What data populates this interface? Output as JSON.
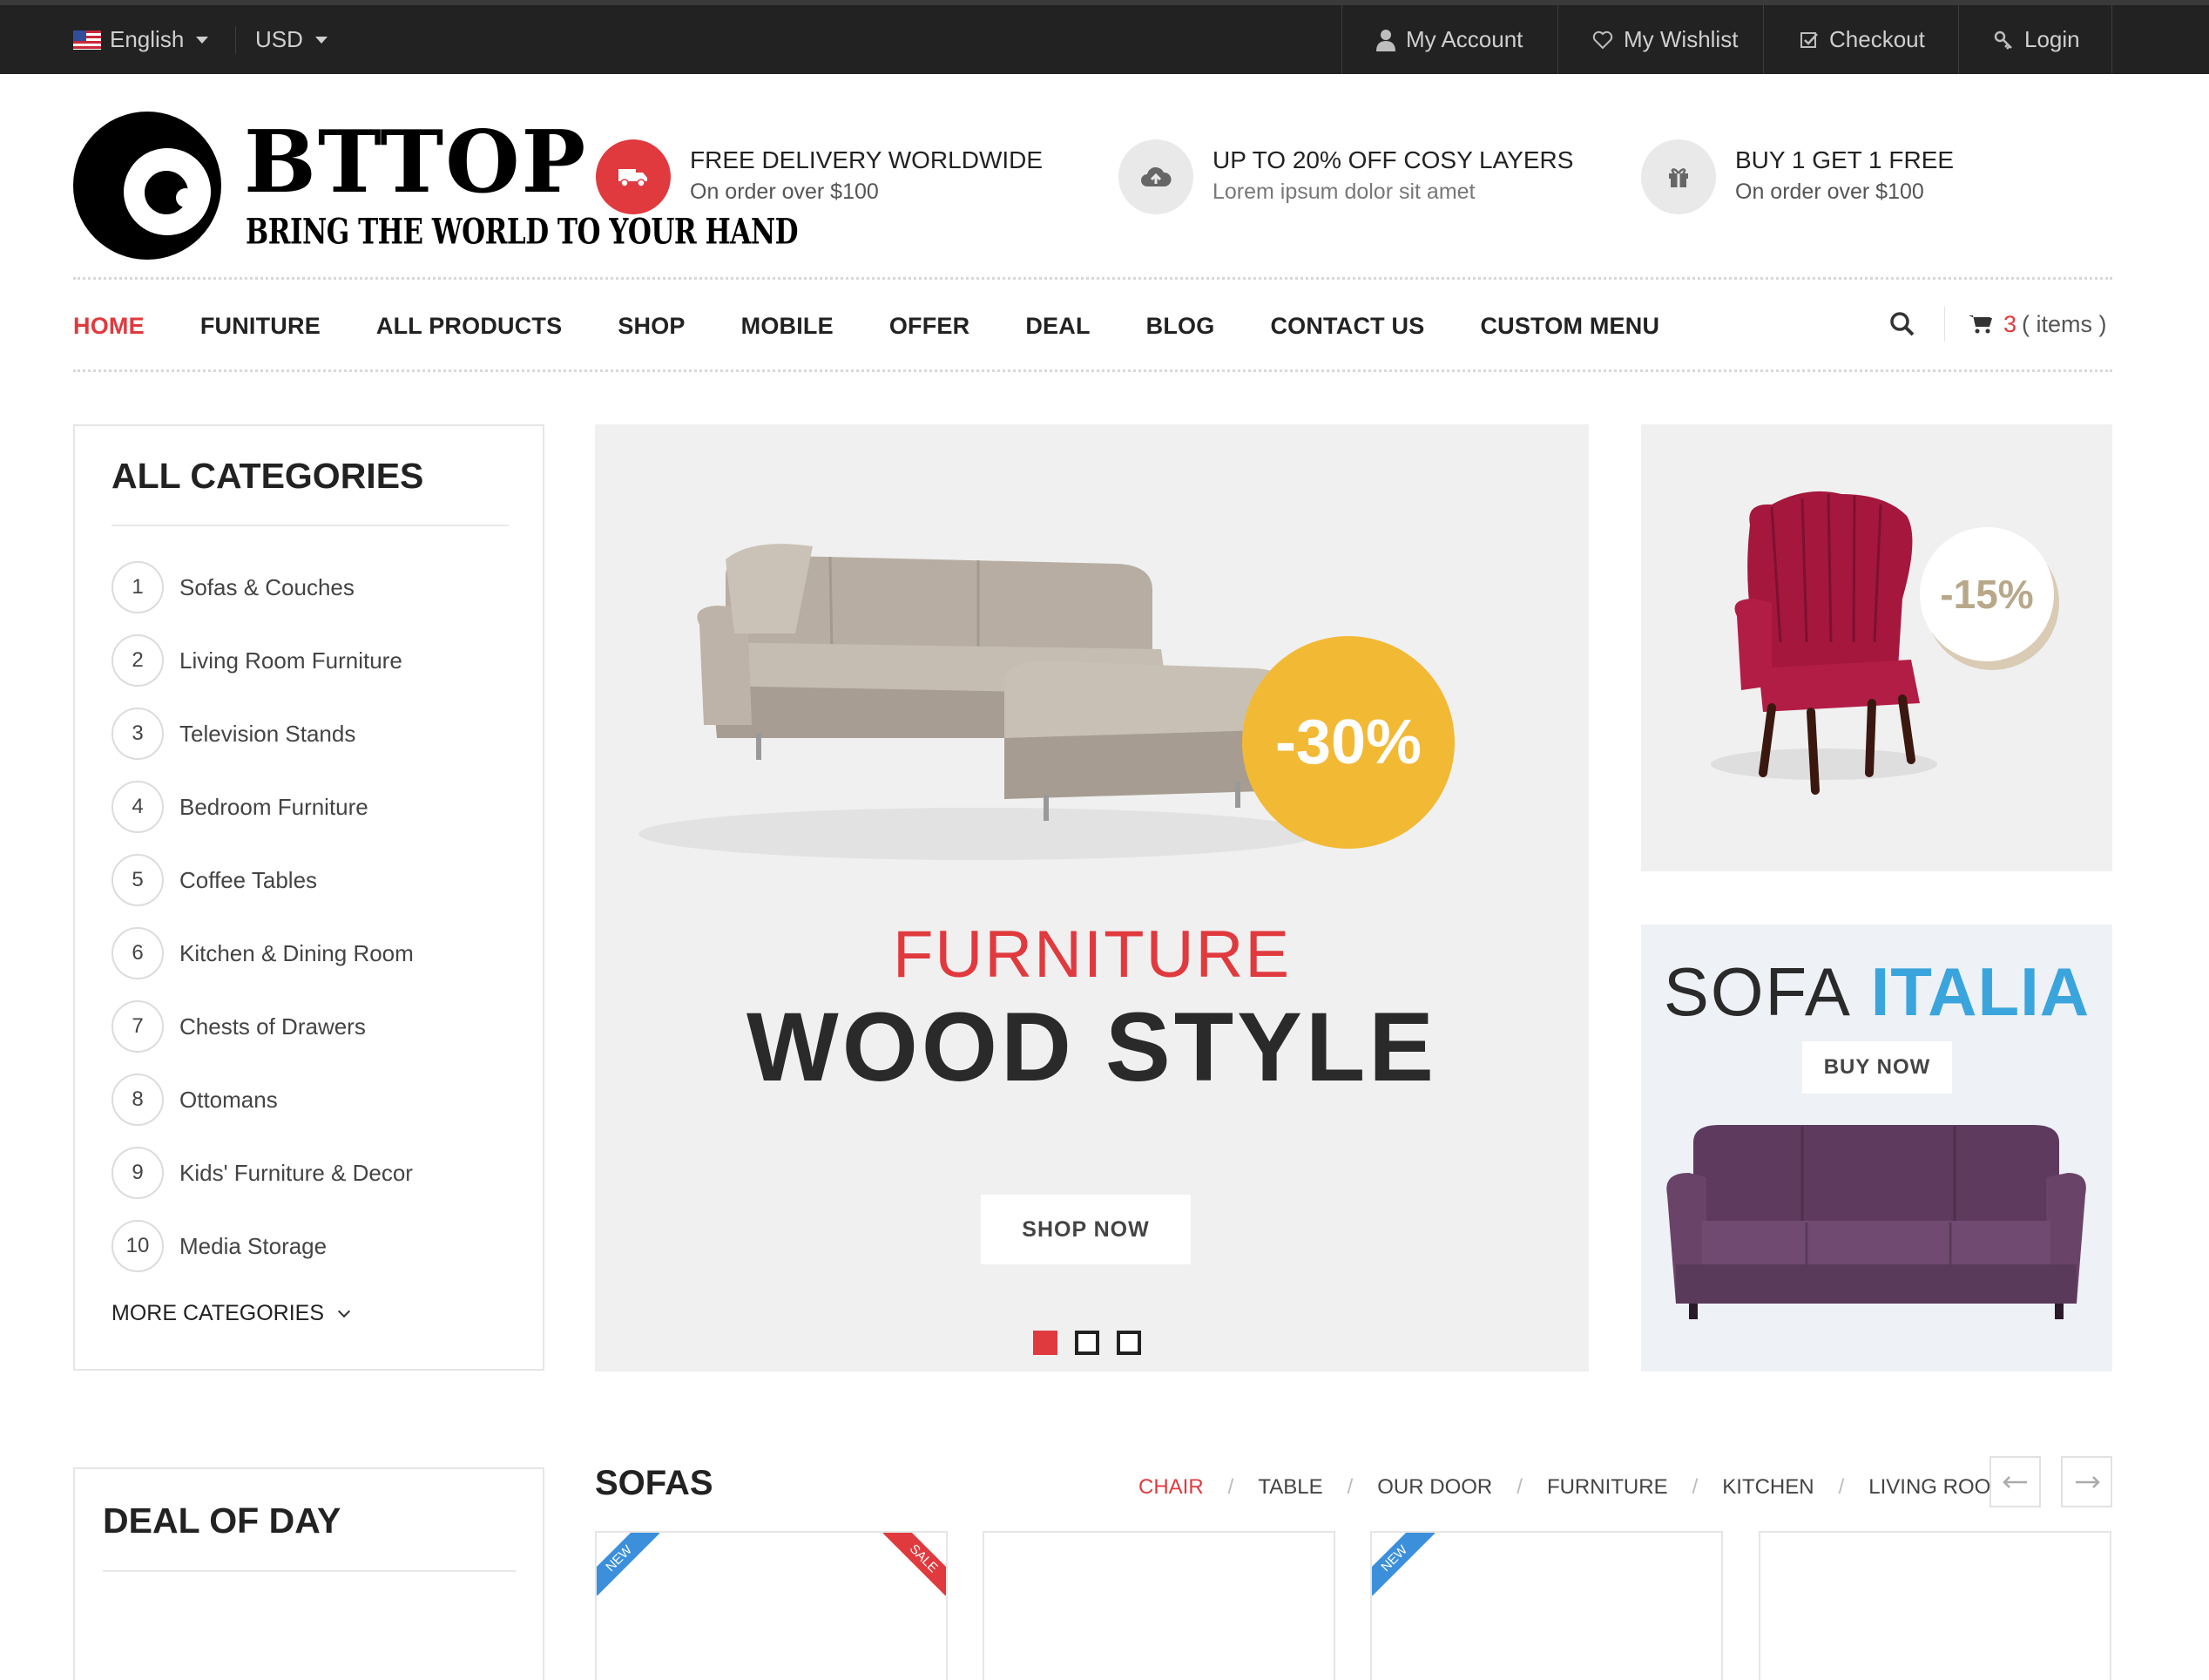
{
  "topbar": {
    "language": "English",
    "currency": "USD",
    "links": [
      {
        "label": "My Account",
        "icon": "user-icon"
      },
      {
        "label": "My Wishlist",
        "icon": "heart-icon"
      },
      {
        "label": "Checkout",
        "icon": "checkbox-icon"
      },
      {
        "label": "Login",
        "icon": "key-icon"
      }
    ]
  },
  "logo": {
    "title": "BTTOP",
    "tagline": "BRING THE WORLD TO YOUR HAND"
  },
  "features": [
    {
      "title": "FREE DELIVERY WORLDWIDE",
      "subtitle": "On order over $100",
      "icon": "truck-icon",
      "color": "#e03a3e"
    },
    {
      "title": "UP TO 20% OFF COSY LAYERS",
      "subtitle": "Lorem ipsum dolor sit amet",
      "icon": "cloud-upload-icon",
      "color": "#e9e9e9"
    },
    {
      "title": "BUY 1 GET 1 FREE",
      "subtitle": "On order over $100",
      "icon": "gift-icon",
      "color": "#e9e9e9"
    }
  ],
  "nav": {
    "items": [
      "HOME",
      "FUNITURE",
      "ALL PRODUCTS",
      "SHOP",
      "MOBILE",
      "OFFER",
      "DEAL",
      "BLOG",
      "CONTACT US",
      "CUSTOM MENU"
    ],
    "active_index": 0,
    "cart_count": "3",
    "cart_label": "( items )"
  },
  "categories": {
    "title": "ALL CATEGORIES",
    "items": [
      {
        "num": "1",
        "label": "Sofas & Couches"
      },
      {
        "num": "2",
        "label": "Living Room Furniture"
      },
      {
        "num": "3",
        "label": "Television Stands"
      },
      {
        "num": "4",
        "label": "Bedroom Furniture"
      },
      {
        "num": "5",
        "label": "Coffee Tables"
      },
      {
        "num": "6",
        "label": "Kitchen & Dining Room"
      },
      {
        "num": "7",
        "label": "Chests of Drawers"
      },
      {
        "num": "8",
        "label": "Ottomans"
      },
      {
        "num": "9",
        "label": "Kids' Furniture & Decor"
      },
      {
        "num": "10",
        "label": "Media Storage"
      }
    ],
    "more_label": "MORE CATEGORIES"
  },
  "slider": {
    "badge": "-30%",
    "line1": "FURNITURE",
    "line2": "WOOD STYLE",
    "button": "SHOP NOW",
    "slide_count": 3,
    "active_slide": 0
  },
  "banners": {
    "chair_badge": "-15%",
    "sofa_word1": "SOFA",
    "sofa_word2": "ITALIA",
    "sofa_button": "BUY NOW"
  },
  "deal": {
    "title": "DEAL OF DAY"
  },
  "sofas_section": {
    "title": "SOFAS",
    "tabs": [
      "CHAIR",
      "TABLE",
      "OUR DOOR",
      "FURNITURE",
      "KITCHEN",
      "LIVING ROOM"
    ],
    "active_tab": 0,
    "cards": [
      {
        "new": "NEW",
        "sale": "SALE"
      },
      {},
      {
        "new": "NEW"
      },
      {}
    ]
  },
  "colors": {
    "accent": "#e03a3e",
    "badge_yellow": "#f2b935",
    "italia_blue": "#3aa5dc",
    "topbar": "#222222"
  }
}
